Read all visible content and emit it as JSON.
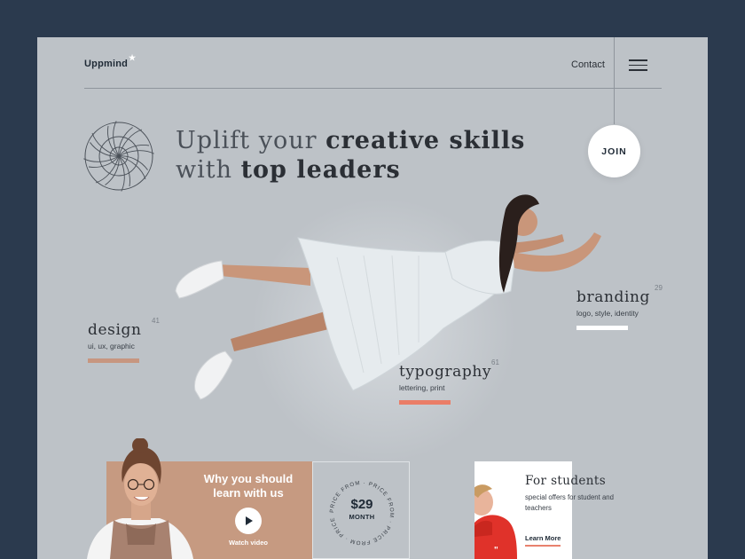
{
  "header": {
    "logo_text": "Uppmind",
    "logo_star": "★",
    "contact_label": "Contact",
    "menu_icon": "hamburger-icon"
  },
  "hero": {
    "headline_line1_light": "Uplift your ",
    "headline_line1_bold": "creative skills",
    "headline_line2_light": "with ",
    "headline_line2_bold": "top leaders",
    "join_label": "JOIN",
    "emblem_icon": "rosette-emblem-icon"
  },
  "categories": [
    {
      "title": "design",
      "number": "41",
      "subtitle": "ui, ux, graphic",
      "color": "#c79680"
    },
    {
      "title": "typography",
      "number": "61",
      "subtitle": "lettering, print",
      "color": "#ea7d67"
    },
    {
      "title": "branding",
      "number": "29",
      "subtitle": "logo, style, identity",
      "color": "#ffffff"
    }
  ],
  "promo": {
    "title": "Why you should learn with us",
    "watch_label": "Watch video",
    "background": "#c69a81"
  },
  "price": {
    "amount": "$29",
    "period": "MONTH",
    "ring_text": "PRICE FROM · PRICE FROM · PRICE FROM · PRICE FROM ·"
  },
  "students": {
    "title": "For students",
    "subtitle": "special offers for student and teachers",
    "link_label": "Learn More",
    "accent": "#e8816d"
  },
  "colors": {
    "frame": "#2b3a4e",
    "page": "#bdc2c7",
    "text": "#2b2f35"
  }
}
